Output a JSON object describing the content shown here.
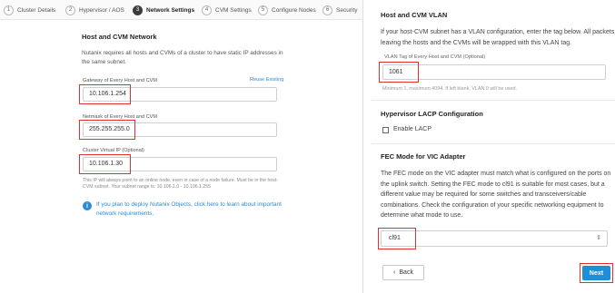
{
  "stepper": {
    "steps": [
      {
        "num": "1",
        "label": "Cluster Details"
      },
      {
        "num": "2",
        "label": "Hypervisor / AOS"
      },
      {
        "num": "3",
        "label": "Network Settings"
      },
      {
        "num": "4",
        "label": "CVM Settings"
      },
      {
        "num": "5",
        "label": "Configure Nodes"
      },
      {
        "num": "6",
        "label": "Security"
      }
    ],
    "active_step": 3
  },
  "network": {
    "title": "Host and CVM Network",
    "description": "Nutanix requires all hosts and CVMs of a cluster to have static IP addresses in the same subnet.",
    "gateway": {
      "label": "Gateway of Every Host and CVM",
      "value": "10.106.1.254",
      "reuse_link": "Reuse Existing"
    },
    "netmask": {
      "label": "Netmask of Every Host and CVM",
      "value": "255.255.255.0"
    },
    "vip": {
      "label": "Cluster Virtual IP (Optional)",
      "value": "10.106.1.30"
    },
    "hint": "This IP will always point to an online node, even in case of a node failure. Must be in the host-CVM subnet. Your subnet range is: 10.106.1.0 - 10.106.1.255",
    "info_icon": "info-icon",
    "info_text": "If you plan to deploy Nutanix Objects, click here to learn about important network requirements."
  },
  "vlan": {
    "title": "Host and CVM VLAN",
    "description": "If your host-CVM subnet has a VLAN configuration, enter the tag below. All packets leaving the hosts and the CVMs will be wrapped with this VLAN tag.",
    "label": "VLAN Tag of Every Host and CVM (Optional)",
    "value": "1061",
    "hint": "Minimum 1, maximum 4094. If left blank, VLAN 0 will be used."
  },
  "lacp": {
    "title": "Hypervisor LACP Configuration",
    "checkbox_label": "Enable LACP",
    "checked": false
  },
  "fec": {
    "title": "FEC Mode for VIC Adapter",
    "description": "The FEC mode on the VIC adapter must match what is configured on the ports on the uplink switch. Setting the FEC mode to cl91 is suitable for most cases, but a different value may be required for some switches and transceivers/cable combinations. Check the configuration of your specific networking equipment to determine what mode to use.",
    "selected": "cl91",
    "arrow": "⇕"
  },
  "footer": {
    "back_label": "Back",
    "back_icon": "‹",
    "next_label": "Next"
  },
  "colors": {
    "accent": "#1d8ed9",
    "highlight": "#e03030",
    "link": "#2a8bd8"
  }
}
